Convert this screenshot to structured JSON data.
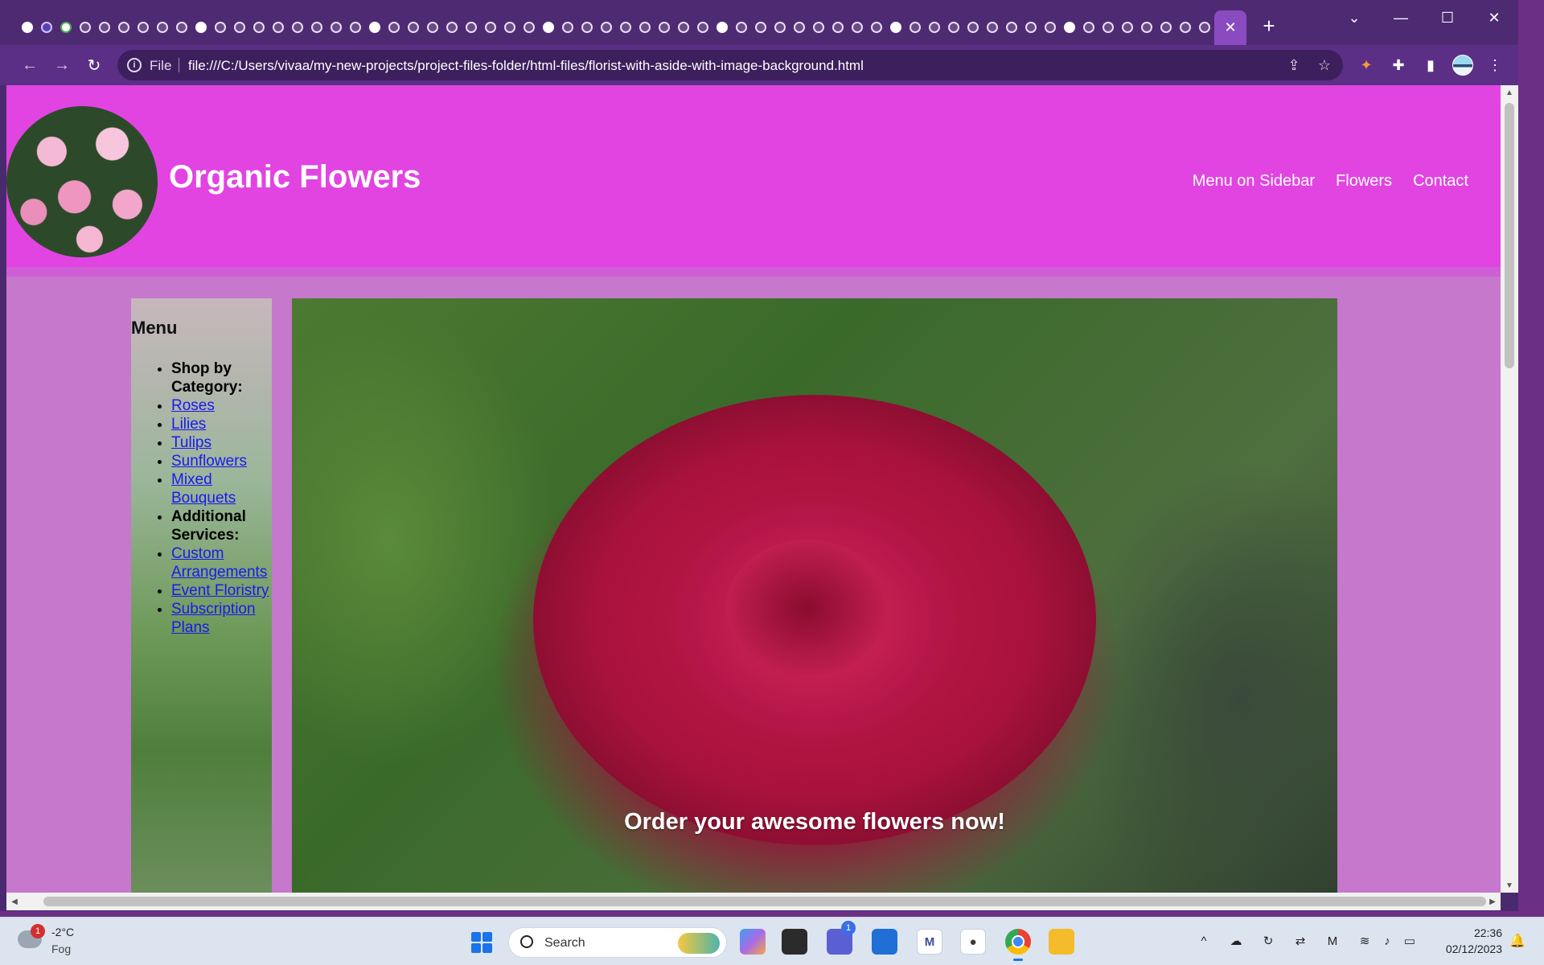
{
  "browser": {
    "active_tab_close": "✕",
    "new_tab": "+",
    "window_controls": {
      "dropdown": "⌄",
      "minimize": "—",
      "maximize": "☐",
      "close": "✕"
    },
    "omnibox": {
      "scheme": "File",
      "url": "file:///C:/Users/vivaa/my-new-projects/project-files-folder/html-files/florist-with-aside-with-image-background.html"
    },
    "nav_icons": {
      "back": "←",
      "forward": "→",
      "reload": "↻"
    },
    "toolbar_icons": {
      "share": "⇪",
      "bookmark": "☆",
      "extension": "✦",
      "puzzle": "✚",
      "sidebar": "▮",
      "menu": "⋮"
    }
  },
  "site": {
    "title": "Organic Flowers",
    "nav": [
      "Menu on Sidebar",
      "Flowers",
      "Contact"
    ],
    "aside": {
      "heading": "Menu",
      "items": [
        {
          "label": "Shop by Category:",
          "type": "heading"
        },
        {
          "label": "Roses",
          "type": "link"
        },
        {
          "label": "Lilies",
          "type": "link"
        },
        {
          "label": "Tulips",
          "type": "link"
        },
        {
          "label": "Sunflowers",
          "type": "link"
        },
        {
          "label": "Mixed Bouquets",
          "type": "link"
        },
        {
          "label": "Additional Services:",
          "type": "heading"
        },
        {
          "label": "Custom Arrangements",
          "type": "link"
        },
        {
          "label": "Event Floristry",
          "type": "link"
        },
        {
          "label": "Subscription Plans",
          "type": "link"
        }
      ]
    },
    "hero_text": "Order your awesome flowers now!"
  },
  "taskbar": {
    "weather": {
      "temp": "-2°C",
      "condition": "Fog",
      "badge": "1"
    },
    "search_label": "Search",
    "clock": {
      "time": "22:36",
      "date": "02/12/2023"
    },
    "chat_badge": "1"
  },
  "colors": {
    "header": "#e244e2",
    "page_bg": "#c678cc",
    "browser_frame": "#5b2f85",
    "link": "#1a1aee"
  }
}
